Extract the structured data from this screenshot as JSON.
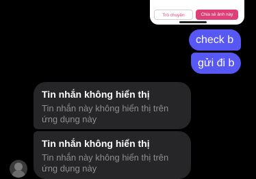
{
  "shared_card": {
    "left_button": "Trò chuyện",
    "right_button": "Chia sẻ ảnh này"
  },
  "messages_out": [
    {
      "text": "check b"
    },
    {
      "text": "gửi đi b"
    }
  ],
  "messages_in": [
    {
      "title": "Tin nhắn không hiển thị",
      "body": "Tin nhắn này không hiển thị trên ứng dụng này"
    },
    {
      "title": "Tin nhắn không hiển thị",
      "body": "Tin nhắn này không hiển thị trên ứng dụng này"
    }
  ],
  "colors": {
    "background": "#000000",
    "outgoing_bubble": "#5757f4",
    "incoming_bubble": "#262628",
    "accent_pink": "#de3f77"
  }
}
